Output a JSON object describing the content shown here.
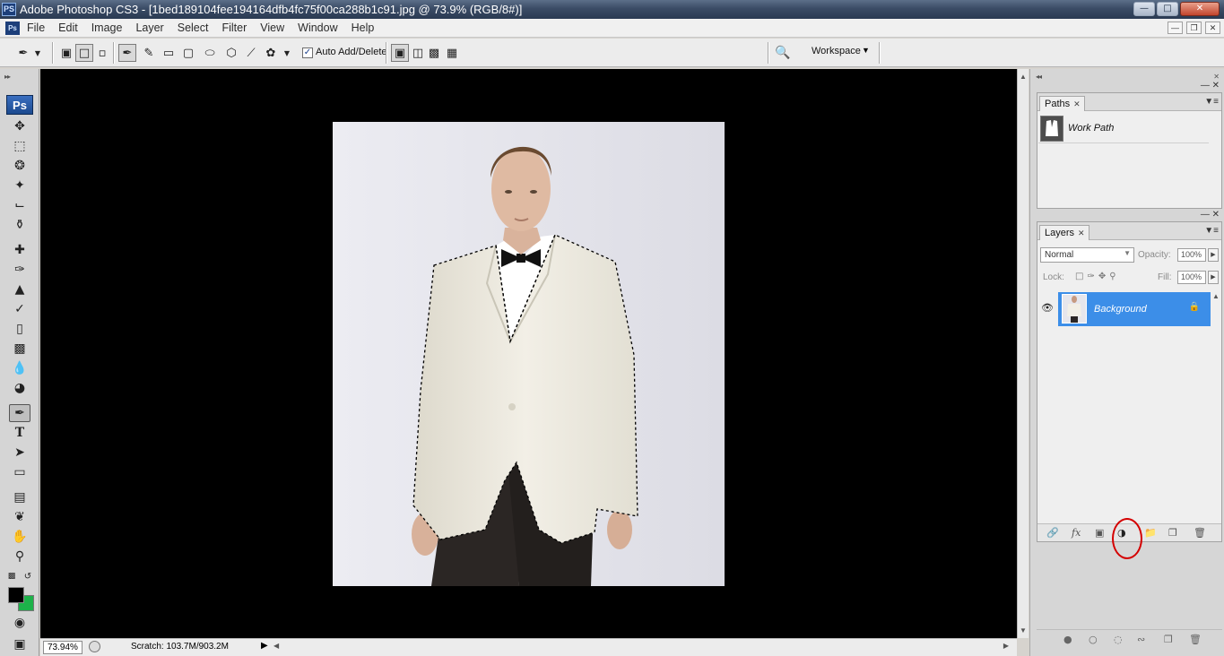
{
  "window": {
    "app_icon": "PS",
    "title": "Adobe Photoshop CS3 - [1bed189104fee194164dfb4fc75f00ca288b1c91.jpg @ 73.9% (RGB/8#)]",
    "controls": [
      "minimize",
      "maximize",
      "close"
    ]
  },
  "menubar": {
    "doc_icon": "Ps",
    "items": [
      "File",
      "Edit",
      "Image",
      "Layer",
      "Select",
      "Filter",
      "View",
      "Window",
      "Help"
    ]
  },
  "options": {
    "auto_add_delete_checked": true,
    "auto_add_delete_label": "Auto Add/Delete",
    "workspace_label": "Workspace"
  },
  "tools": {
    "logo": "Ps",
    "active_tool": "pen-tool",
    "foreground_color": "#000000",
    "background_color": "#1db24a"
  },
  "status": {
    "zoom": "73.94%",
    "scratch": "Scratch: 103.7M/903.2M"
  },
  "paths_panel": {
    "tab": "Paths",
    "items": [
      {
        "name": "Work Path"
      }
    ]
  },
  "layers_panel": {
    "tab": "Layers",
    "blend_mode": "Normal",
    "opacity_label": "Opacity:",
    "opacity": "100%",
    "lock_label": "Lock:",
    "fill_label": "Fill:",
    "fill": "100%",
    "layers": [
      {
        "name": "Background",
        "visible": true,
        "locked": true,
        "selected": true
      }
    ],
    "highlight_color": "#d40000"
  },
  "colors": {
    "selection": "#3c8ee8",
    "canvas_bg": "#000000"
  }
}
